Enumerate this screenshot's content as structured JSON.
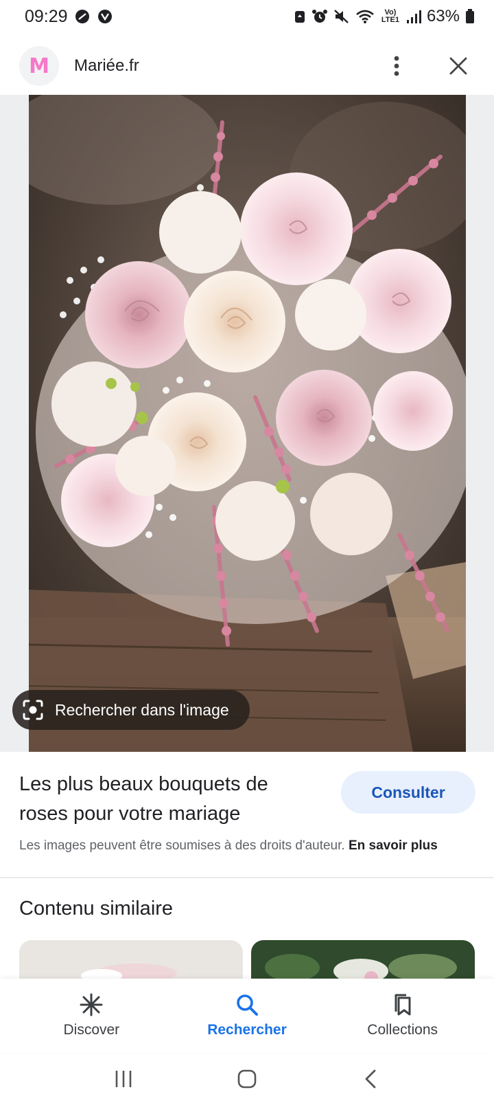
{
  "status_bar": {
    "time": "09:29",
    "battery": "63%",
    "network": "Vo) LTE1"
  },
  "source": {
    "favicon_letter": "M",
    "name": "Mariée.fr"
  },
  "lens": {
    "label": "Rechercher dans l'image"
  },
  "result": {
    "title": "Les plus beaux bouquets de roses pour votre mariage",
    "visit_label": "Consulter",
    "copyright_text": "Les images peuvent être soumises à des droits d'auteur.",
    "learn_more": "En savoir plus"
  },
  "similar": {
    "heading": "Contenu similaire"
  },
  "bottom_nav": {
    "discover": "Discover",
    "search": "Rechercher",
    "collections": "Collections"
  },
  "colors": {
    "accent": "#1a73e8",
    "favicon": "#f778c9",
    "visit_bg": "#e8f0fe"
  }
}
